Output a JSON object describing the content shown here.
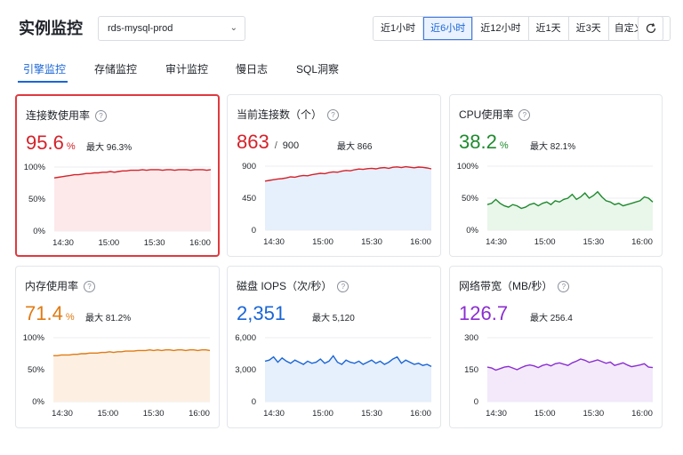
{
  "page": {
    "title": "实例监控"
  },
  "instance": {
    "selected": "rds-mysql-prod"
  },
  "time_ranges": [
    {
      "label": "近1小时",
      "active": false
    },
    {
      "label": "近6小时",
      "active": true
    },
    {
      "label": "近12小时",
      "active": false
    },
    {
      "label": "近1天",
      "active": false
    },
    {
      "label": "近3天",
      "active": false
    },
    {
      "label": "自定义",
      "active": false
    }
  ],
  "tabs": [
    {
      "label": "引擎监控",
      "active": true
    },
    {
      "label": "存储监控",
      "active": false
    },
    {
      "label": "审计监控",
      "active": false
    },
    {
      "label": "慢日志",
      "active": false
    },
    {
      "label": "SQL洞察",
      "active": false
    }
  ],
  "cards": [
    {
      "id": "conn-usage",
      "title": "连接数使用率",
      "value": "95.6",
      "unit": "%",
      "cap": "",
      "max_label": "最大",
      "max": "96.3%",
      "color": "#d4222a",
      "fill": "#fde9ea",
      "selected": true,
      "chart_data": {
        "type": "area",
        "x_ticks": [
          "14:30",
          "15:00",
          "15:30",
          "16:00"
        ],
        "y_ticks": [
          "0%",
          "50%",
          "100%"
        ],
        "ylim": [
          0,
          100
        ],
        "values": [
          83,
          84,
          85,
          86,
          87,
          88,
          88,
          89,
          90,
          90,
          91,
          91,
          92,
          92,
          93,
          92,
          93,
          94,
          94,
          95,
          95,
          95,
          96,
          95,
          96,
          96,
          96,
          95,
          96,
          96,
          95,
          96,
          96,
          96,
          95,
          96,
          96,
          96,
          95,
          96
        ]
      }
    },
    {
      "id": "current-conn",
      "title": "当前连接数（个）",
      "value": "863",
      "unit": "",
      "cap": "900",
      "max_label": "最大",
      "max": "866",
      "color": "#d4222a",
      "fill": "#e6effc",
      "selected": false,
      "chart_data": {
        "type": "area",
        "x_ticks": [
          "14:30",
          "15:00",
          "15:30",
          "16:00"
        ],
        "y_ticks": [
          "0",
          "450",
          "900"
        ],
        "ylim": [
          0,
          900
        ],
        "values": [
          690,
          700,
          710,
          720,
          725,
          735,
          750,
          745,
          760,
          770,
          765,
          780,
          790,
          800,
          795,
          810,
          820,
          815,
          830,
          840,
          835,
          850,
          860,
          855,
          865,
          870,
          862,
          875,
          880,
          870,
          885,
          890,
          880,
          892,
          885,
          878,
          888,
          884,
          875,
          862
        ]
      }
    },
    {
      "id": "cpu-usage",
      "title": "CPU使用率",
      "value": "38.2",
      "unit": "%",
      "cap": "",
      "max_label": "最大",
      "max": "82.1%",
      "color": "#1f8a2e",
      "fill": "#e9f6ea",
      "selected": false,
      "chart_data": {
        "type": "area",
        "x_ticks": [
          "14:30",
          "15:00",
          "15:30",
          "16:00"
        ],
        "y_ticks": [
          "0%",
          "50%",
          "100%"
        ],
        "ylim": [
          0,
          100
        ],
        "values": [
          40,
          42,
          48,
          42,
          38,
          36,
          40,
          38,
          34,
          36,
          40,
          42,
          38,
          42,
          44,
          40,
          46,
          44,
          48,
          50,
          56,
          48,
          52,
          58,
          50,
          54,
          60,
          52,
          46,
          44,
          40,
          42,
          38,
          40,
          42,
          44,
          46,
          52,
          50,
          44
        ]
      }
    },
    {
      "id": "mem-usage",
      "title": "内存使用率",
      "value": "71.4",
      "unit": "%",
      "cap": "",
      "max_label": "最大",
      "max": "81.2%",
      "color": "#e07a12",
      "fill": "#fdf0e3",
      "selected": false,
      "chart_data": {
        "type": "area",
        "x_ticks": [
          "14:30",
          "15:00",
          "15:30",
          "16:00"
        ],
        "y_ticks": [
          "0%",
          "50%",
          "100%"
        ],
        "ylim": [
          0,
          100
        ],
        "values": [
          72,
          72,
          73,
          73,
          73,
          74,
          74,
          75,
          75,
          76,
          76,
          76,
          77,
          77,
          78,
          77,
          78,
          78,
          79,
          79,
          79,
          80,
          80,
          80,
          81,
          80,
          81,
          80,
          81,
          81,
          80,
          81,
          81,
          80,
          81,
          81,
          80,
          81,
          81,
          80
        ]
      }
    },
    {
      "id": "disk-iops",
      "title": "磁盘 IOPS（次/秒）",
      "value": "2,351",
      "unit": "",
      "cap": "",
      "max_label": "最大",
      "max": "5,120",
      "color": "#1a66d6",
      "fill": "#e6effc",
      "selected": false,
      "chart_data": {
        "type": "area",
        "x_ticks": [
          "14:30",
          "15:00",
          "15:30",
          "16:00"
        ],
        "y_ticks": [
          "0",
          "3,000",
          "6,000"
        ],
        "ylim": [
          0,
          6000
        ],
        "values": [
          3800,
          3900,
          4200,
          3700,
          4100,
          3800,
          3600,
          3900,
          3700,
          3500,
          3800,
          3600,
          3700,
          4000,
          3600,
          3800,
          4300,
          3700,
          3500,
          3900,
          3700,
          3600,
          3800,
          3500,
          3700,
          3900,
          3600,
          3800,
          3500,
          3700,
          4000,
          4200,
          3600,
          3900,
          3700,
          3500,
          3600,
          3400,
          3500,
          3300
        ]
      }
    },
    {
      "id": "net-bandwidth",
      "title": "网络带宽（MB/秒）",
      "value": "126.7",
      "unit": "",
      "cap": "",
      "max_label": "最大",
      "max": "256.4",
      "color": "#8b2ed1",
      "fill": "#f3e9fb",
      "selected": false,
      "chart_data": {
        "type": "area",
        "x_ticks": [
          "14:30",
          "15:00",
          "15:30",
          "16:00"
        ],
        "y_ticks": [
          "0",
          "150",
          "300"
        ],
        "ylim": [
          0,
          300
        ],
        "values": [
          162,
          158,
          148,
          155,
          162,
          165,
          158,
          150,
          160,
          168,
          172,
          168,
          160,
          170,
          175,
          168,
          178,
          182,
          176,
          170,
          182,
          190,
          200,
          194,
          184,
          190,
          196,
          188,
          180,
          186,
          170,
          176,
          182,
          172,
          164,
          168,
          172,
          178,
          162,
          160
        ]
      }
    }
  ]
}
